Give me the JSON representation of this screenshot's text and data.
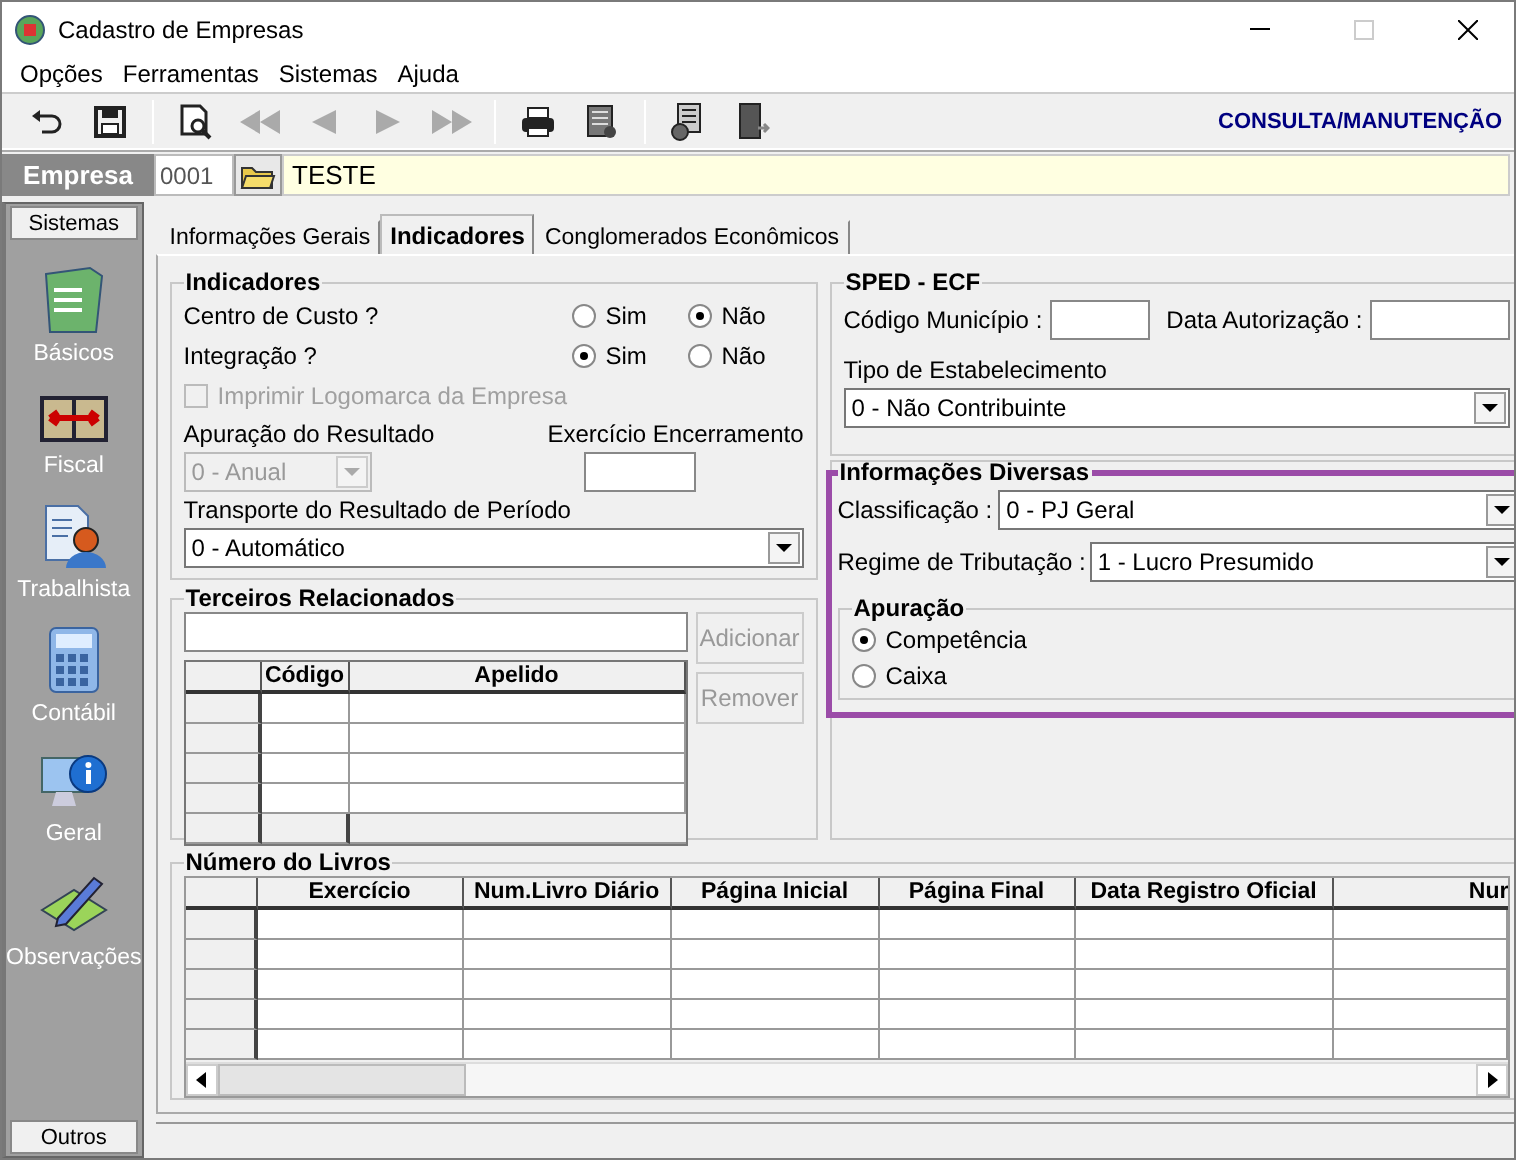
{
  "window": {
    "title": "Cadastro de Empresas"
  },
  "menu": [
    "Opções",
    "Ferramentas",
    "Sistemas",
    "Ajuda"
  ],
  "toolbar": [
    {
      "kind": "undo",
      "disabled": false
    },
    {
      "kind": "save",
      "disabled": false
    },
    {
      "kind": "preview",
      "disabled": false
    },
    {
      "kind": "first",
      "disabled": true
    },
    {
      "kind": "prev",
      "disabled": true
    },
    {
      "kind": "next",
      "disabled": true
    },
    {
      "kind": "last",
      "disabled": true
    },
    {
      "kind": "print",
      "disabled": false
    },
    {
      "kind": "report",
      "disabled": false
    },
    {
      "kind": "tool",
      "disabled": false
    },
    {
      "kind": "exit",
      "disabled": false
    }
  ],
  "mode": "CONSULTA/MANUTENÇÃO",
  "company": {
    "label": "Empresa",
    "code": "0001",
    "name": "TESTE"
  },
  "sidebar": {
    "header": "Sistemas",
    "items": [
      "Básicos",
      "Fiscal",
      "Trabalhista",
      "Contábil",
      "Geral",
      "Observações"
    ],
    "footer": "Outros"
  },
  "tabs": [
    {
      "label": "Informações Gerais",
      "selected": false
    },
    {
      "label": "Indicadores",
      "selected": true
    },
    {
      "label": "Conglomerados Econômicos",
      "selected": false
    }
  ],
  "indicadores": {
    "title": "Indicadores",
    "questions": [
      {
        "label": "Centro de Custo ?",
        "options": [
          {
            "label": "Sim",
            "selected": false
          },
          {
            "label": "Não",
            "selected": true
          }
        ]
      },
      {
        "label": "Integração ?",
        "options": [
          {
            "label": "Sim",
            "selected": true
          },
          {
            "label": "Não",
            "selected": false
          }
        ]
      }
    ],
    "logo_checkbox": {
      "label": "Imprimir Logomarca da Empresa",
      "checked": false,
      "disabled": true
    },
    "apuracao": {
      "label": "Apuração do Resultado",
      "value": "0 - Anual",
      "disabled": true
    },
    "exercicio": {
      "label": "Exercício Encerramento"
    },
    "transporte": {
      "label": "Transporte do Resultado de Período",
      "value": "0 - Automático"
    }
  },
  "terceiros": {
    "title": "Terceiros Relacionados",
    "buttons": [
      {
        "label": "Adicionar",
        "disabled": true
      },
      {
        "label": "Remover",
        "disabled": true
      }
    ],
    "columns": [
      "Código",
      "Apelido"
    ]
  },
  "sped": {
    "title": "SPED - ECF",
    "codigo_municipio": {
      "label": "Código Município :"
    },
    "data_autorizacao": {
      "label": "Data Autorização :"
    },
    "tipo": {
      "label": "Tipo de Estabelecimento",
      "value": "0 - Não Contribuinte"
    }
  },
  "diversas": {
    "title": "Informações Diversas",
    "highlighted": true,
    "classificacao": {
      "label": "Classificação :",
      "value": "0 - PJ Geral"
    },
    "regime": {
      "label": "Regime de Tributação :",
      "value": "1 - Lucro Presumido"
    },
    "apuracao": {
      "title": "Apuração",
      "options": [
        {
          "label": "Competência",
          "selected": true
        },
        {
          "label": "Caixa",
          "selected": false
        }
      ]
    }
  },
  "livros": {
    "title": "Número do Livros",
    "columns": [
      "Exercício",
      "Num.Livro Diário",
      "Página Inicial",
      "Página Final",
      "Data Registro Oficial",
      "Nur"
    ]
  }
}
